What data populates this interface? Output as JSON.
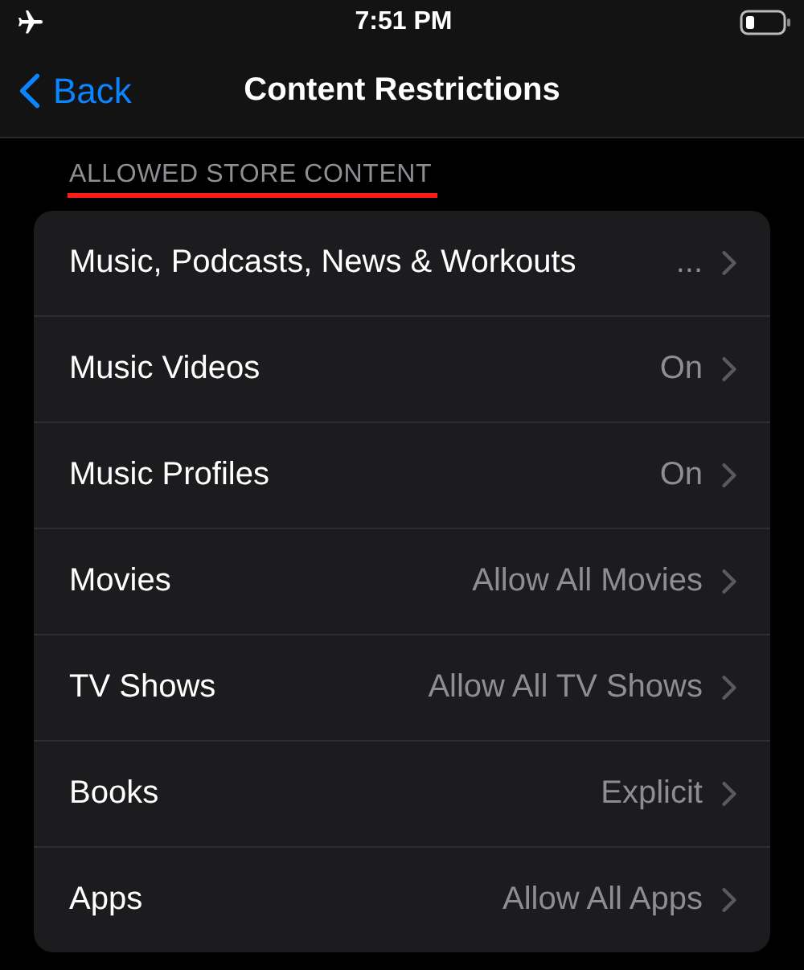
{
  "status_bar": {
    "time": "7:51 PM"
  },
  "nav": {
    "back": "Back",
    "title": "Content Restrictions"
  },
  "section": {
    "header": "ALLOWED STORE CONTENT",
    "underlined": true
  },
  "rows": [
    {
      "label": "Music, Podcasts, News & Workouts",
      "value": "..."
    },
    {
      "label": "Music Videos",
      "value": "On"
    },
    {
      "label": "Music Profiles",
      "value": "On"
    },
    {
      "label": "Movies",
      "value": "Allow All Movies"
    },
    {
      "label": "TV Shows",
      "value": "Allow All TV Shows"
    },
    {
      "label": "Books",
      "value": "Explicit"
    },
    {
      "label": "Apps",
      "value": "Allow All Apps"
    }
  ]
}
